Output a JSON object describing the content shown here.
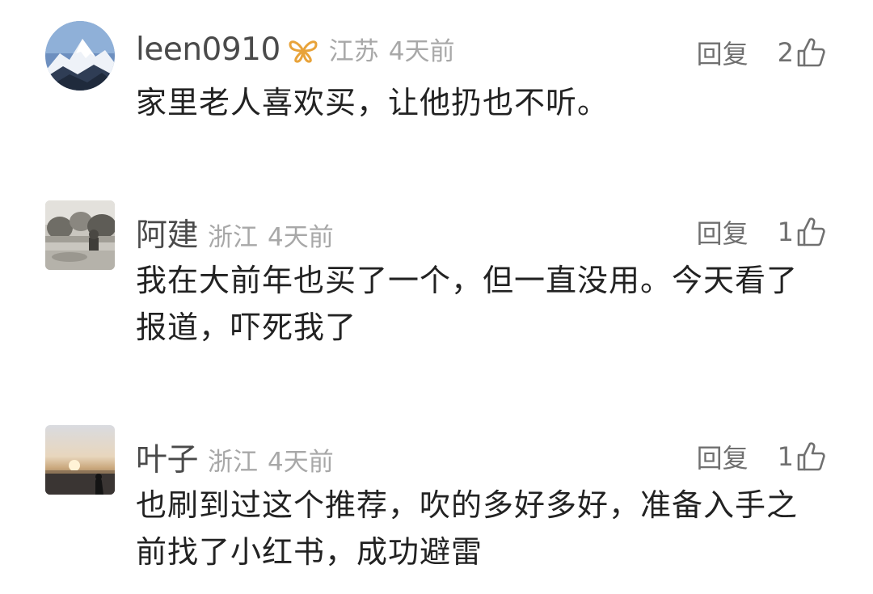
{
  "comments": [
    {
      "username": "leen0910",
      "avatar": "snow-mountain-avatar",
      "badge": "vip-butterfly-icon",
      "location": "江苏",
      "time": "4天前",
      "reply_label": "回复",
      "likes": "2",
      "text": "家里老人喜欢买，让他扔也不听。"
    },
    {
      "username": "阿建",
      "avatar": "garden-photo-avatar",
      "location": "浙江",
      "time": "4天前",
      "reply_label": "回复",
      "likes": "1",
      "text": "我在大前年也买了一个，但一直没用。今天看了报道，吓死我了"
    },
    {
      "username": "叶子",
      "avatar": "sunset-avatar",
      "location": "浙江",
      "time": "4天前",
      "reply_label": "回复",
      "likes": "1",
      "text": "也刷到过这个推荐，吹的多好多好，准备入手之前找了小红书，成功避雷"
    }
  ],
  "colors": {
    "username": "#4a4a4a",
    "meta": "#a8a8a8",
    "action": "#707070",
    "vip": "#e8a33a",
    "text": "#222222"
  },
  "icons": {
    "like": "thumbs-up-icon",
    "vip": "butterfly-icon"
  }
}
